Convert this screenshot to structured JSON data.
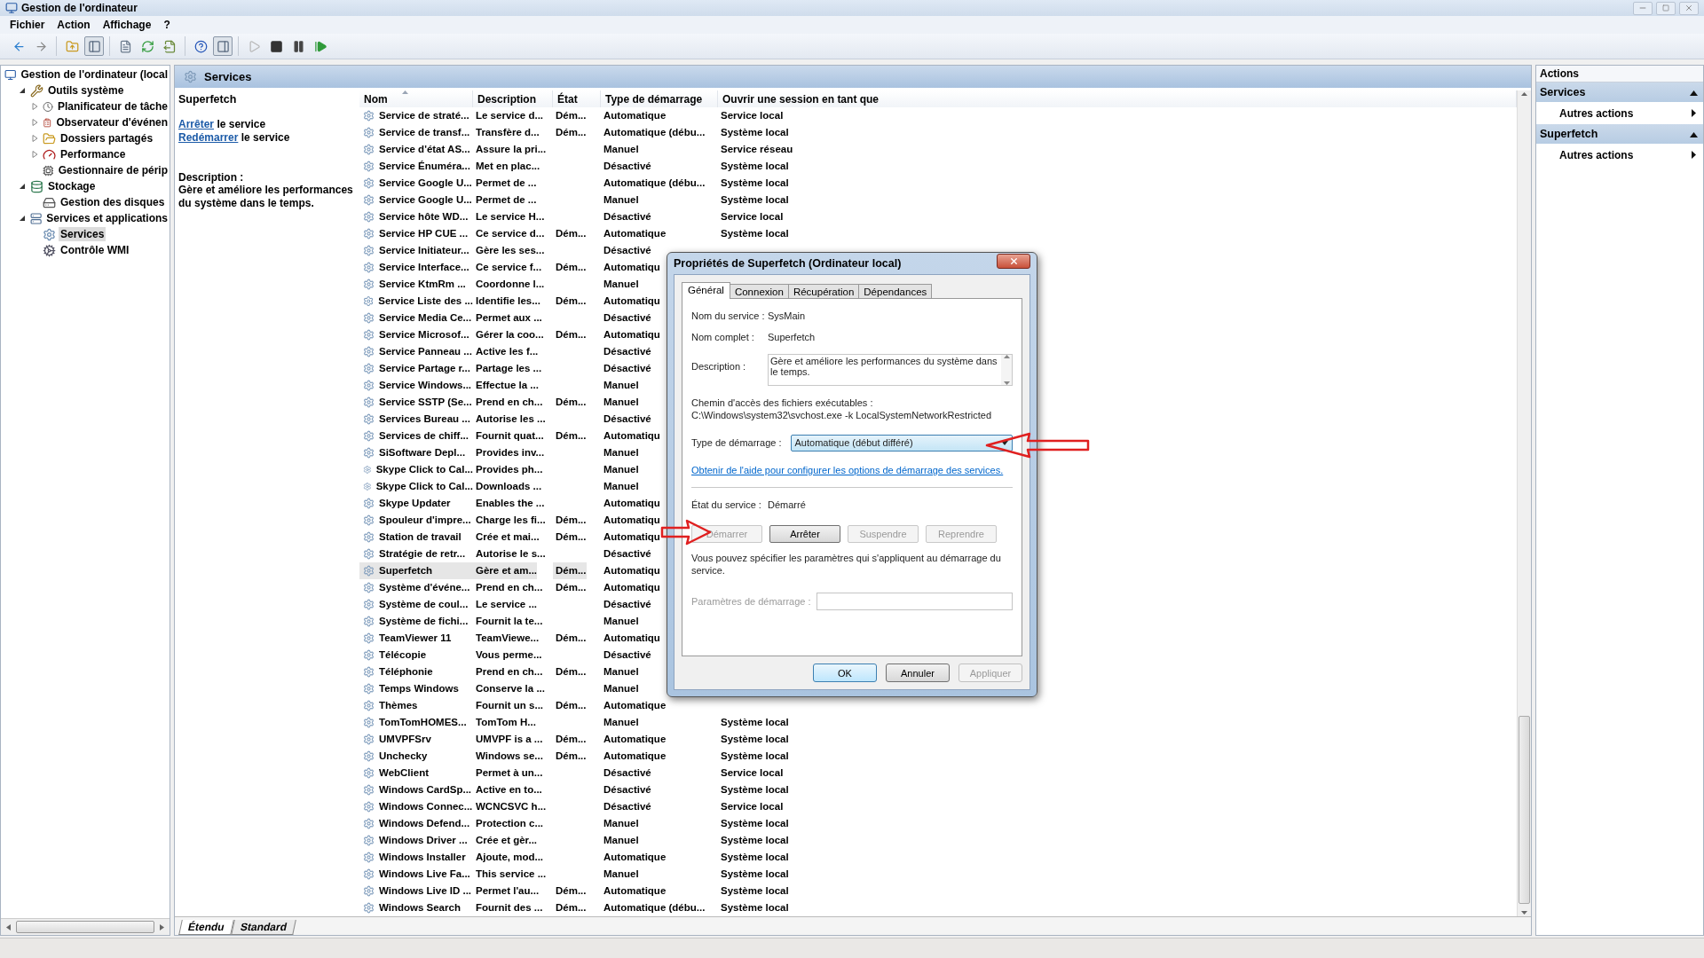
{
  "window": {
    "title": "Gestion de l'ordinateur"
  },
  "menu": [
    "Fichier",
    "Action",
    "Affichage",
    "?"
  ],
  "toolbar": [
    [
      {
        "pressed": false,
        "disabled": false
      },
      {
        "pressed": false,
        "disabled": false
      }
    ],
    [
      {
        "pressed": false,
        "disabled": false
      },
      {
        "pressed": true,
        "disabled": false
      }
    ],
    [
      {
        "pressed": false,
        "disabled": false
      },
      {
        "pressed": false,
        "disabled": false
      },
      {
        "pressed": false,
        "disabled": false
      }
    ],
    [
      {
        "pressed": false,
        "disabled": false
      },
      {
        "pressed": true,
        "disabled": false
      }
    ],
    [
      {
        "pressed": false,
        "disabled": true
      },
      {
        "pressed": false,
        "disabled": false
      },
      {
        "pressed": false,
        "disabled": false
      },
      {
        "pressed": false,
        "disabled": false
      }
    ]
  ],
  "tree": [
    {
      "label": "Gestion de l'ordinateur (local",
      "kind": "computer",
      "selected": false,
      "children": [
        {
          "label": "Outils système",
          "kind": "tools",
          "expanded": true,
          "selected": false,
          "children": [
            {
              "label": "Planificateur de tâche",
              "kind": "clock",
              "expanded": false,
              "selected": false
            },
            {
              "label": "Observateur d'événen",
              "kind": "log",
              "expanded": false,
              "selected": false
            },
            {
              "label": "Dossiers partagés",
              "kind": "folder",
              "expanded": false,
              "selected": false
            },
            {
              "label": "Performance",
              "kind": "gauge",
              "expanded": false,
              "selected": false
            },
            {
              "label": "Gestionnaire de périp",
              "kind": "device",
              "selected": false
            }
          ]
        },
        {
          "label": "Stockage",
          "kind": "storage",
          "expanded": true,
          "selected": false,
          "children": [
            {
              "label": "Gestion des disques",
              "kind": "disk",
              "selected": false
            }
          ]
        },
        {
          "label": "Services et applications",
          "kind": "server",
          "expanded": true,
          "selected": false,
          "children": [
            {
              "label": "Services",
              "kind": "services",
              "selected": true
            },
            {
              "label": "Contrôle WMI",
              "kind": "wmi",
              "selected": false
            }
          ]
        }
      ]
    }
  ],
  "panel_title": "Services",
  "detail": {
    "title": "Superfetch",
    "actions": [
      {
        "link": "Arrêter",
        "text": "le service"
      },
      {
        "link": "Redémarrer",
        "text": "le service"
      }
    ],
    "description_label": "Description :",
    "description": "Gère et améliore les performances du système dans le temps."
  },
  "table": {
    "columns": [
      {
        "label": "Nom",
        "sorted": true
      },
      {
        "label": "Description",
        "sorted": false
      },
      {
        "label": "État",
        "sorted": false
      },
      {
        "label": "Type de démarrage",
        "sorted": false
      },
      {
        "label": "Ouvrir une session en tant que",
        "sorted": false
      }
    ],
    "rows": [
      {
        "name": "Service de straté...",
        "description": "Le service d...",
        "state": "Dém...",
        "startup": "Automatique",
        "logon": "Service local",
        "selected": false
      },
      {
        "name": "Service de transf...",
        "description": "Transfère d...",
        "state": "Dém...",
        "startup": "Automatique (débu...",
        "logon": "Système local",
        "selected": false
      },
      {
        "name": "Service d'état AS...",
        "description": "Assure la pri...",
        "startup": "Manuel",
        "logon": "Service réseau",
        "selected": false
      },
      {
        "name": "Service Énuméra...",
        "description": "Met en plac...",
        "startup": "Désactivé",
        "logon": "Système local",
        "selected": false
      },
      {
        "name": "Service Google U...",
        "description": "Permet de ...",
        "startup": "Automatique (débu...",
        "logon": "Système local",
        "selected": false
      },
      {
        "name": "Service Google U...",
        "description": "Permet de ...",
        "startup": "Manuel",
        "logon": "Système local",
        "selected": false
      },
      {
        "name": "Service hôte WD...",
        "description": "Le service H...",
        "startup": "Désactivé",
        "logon": "Service local",
        "selected": false
      },
      {
        "name": "Service HP CUE ...",
        "description": "Ce service d...",
        "state": "Dém...",
        "startup": "Automatique",
        "logon": "Système local",
        "selected": false
      },
      {
        "name": "Service Initiateur...",
        "description": "Gère les ses...",
        "startup": "Désactivé",
        "selected": false
      },
      {
        "name": "Service Interface...",
        "description": "Ce service f...",
        "state": "Dém...",
        "startup": "Automatiqu",
        "selected": false
      },
      {
        "name": "Service KtmRm ...",
        "description": "Coordonne l...",
        "startup": "Manuel",
        "selected": false
      },
      {
        "name": "Service Liste des ...",
        "description": "Identifie les...",
        "state": "Dém...",
        "startup": "Automatiqu",
        "selected": false
      },
      {
        "name": "Service Media Ce...",
        "description": "Permet aux ...",
        "startup": "Désactivé",
        "selected": false
      },
      {
        "name": "Service Microsof...",
        "description": "Gérer la coo...",
        "state": "Dém...",
        "startup": "Automatiqu",
        "selected": false
      },
      {
        "name": "Service Panneau ...",
        "description": "Active les f...",
        "startup": "Désactivé",
        "selected": false
      },
      {
        "name": "Service Partage r...",
        "description": "Partage les ...",
        "startup": "Désactivé",
        "selected": false
      },
      {
        "name": "Service Windows...",
        "description": "Effectue la ...",
        "startup": "Manuel",
        "selected": false
      },
      {
        "name": "Service SSTP (Se...",
        "description": "Prend en ch...",
        "state": "Dém...",
        "startup": "Manuel",
        "selected": false
      },
      {
        "name": "Services Bureau ...",
        "description": "Autorise les ...",
        "startup": "Désactivé",
        "selected": false
      },
      {
        "name": "Services de chiff...",
        "description": "Fournit quat...",
        "state": "Dém...",
        "startup": "Automatiqu",
        "selected": false
      },
      {
        "name": "SiSoftware Depl...",
        "description": "Provides inv...",
        "startup": "Manuel",
        "selected": false
      },
      {
        "name": "Skype Click to Cal...",
        "description": "Provides ph...",
        "startup": "Manuel",
        "selected": false
      },
      {
        "name": "Skype Click to Cal...",
        "description": "Downloads ...",
        "startup": "Manuel",
        "selected": false
      },
      {
        "name": "Skype Updater",
        "description": "Enables the ...",
        "startup": "Automatiqu",
        "selected": false
      },
      {
        "name": "Spouleur d'impre...",
        "description": "Charge les fi...",
        "state": "Dém...",
        "startup": "Automatiqu",
        "selected": false
      },
      {
        "name": "Station de travail",
        "description": "Crée et mai...",
        "state": "Dém...",
        "startup": "Automatiqu",
        "selected": false
      },
      {
        "name": "Stratégie de retr...",
        "description": "Autorise le s...",
        "startup": "Désactivé",
        "selected": false
      },
      {
        "name": "Superfetch",
        "description": "Gère et am...",
        "state": "Dém...",
        "startup": "Automatiqu",
        "selected": true
      },
      {
        "name": "Système d'événe...",
        "description": "Prend en ch...",
        "state": "Dém...",
        "startup": "Automatiqu",
        "selected": false
      },
      {
        "name": "Système de coul...",
        "description": "Le service ...",
        "startup": "Désactivé",
        "selected": false
      },
      {
        "name": "Système de fichi...",
        "description": "Fournit la te...",
        "startup": "Manuel",
        "selected": false
      },
      {
        "name": "TeamViewer 11",
        "description": "TeamViewe...",
        "state": "Dém...",
        "startup": "Automatiqu",
        "selected": false
      },
      {
        "name": "Télécopie",
        "description": "Vous perme...",
        "startup": "Désactivé",
        "selected": false
      },
      {
        "name": "Téléphonie",
        "description": "Prend en ch...",
        "state": "Dém...",
        "startup": "Manuel",
        "selected": false
      },
      {
        "name": "Temps Windows",
        "description": "Conserve la ...",
        "startup": "Manuel",
        "selected": false
      },
      {
        "name": "Thèmes",
        "description": "Fournit un s...",
        "state": "Dém...",
        "startup": "Automatique",
        "selected": false
      },
      {
        "name": "TomTomHOMES...",
        "description": "TomTom H...",
        "startup": "Manuel",
        "logon": "Système local",
        "selected": false
      },
      {
        "name": "UMVPFSrv",
        "description": "UMVPF is a ...",
        "state": "Dém...",
        "startup": "Automatique",
        "logon": "Système local",
        "selected": false
      },
      {
        "name": "Unchecky",
        "description": "Windows se...",
        "state": "Dém...",
        "startup": "Automatique",
        "logon": "Système local",
        "selected": false
      },
      {
        "name": "WebClient",
        "description": "Permet à un...",
        "startup": "Désactivé",
        "logon": "Service local",
        "selected": false
      },
      {
        "name": "Windows CardSp...",
        "description": "Active en to...",
        "startup": "Désactivé",
        "logon": "Système local",
        "selected": false
      },
      {
        "name": "Windows Connec...",
        "description": "WCNCSVC h...",
        "startup": "Désactivé",
        "logon": "Service local",
        "selected": false
      },
      {
        "name": "Windows Defend...",
        "description": "Protection c...",
        "startup": "Manuel",
        "logon": "Système local",
        "selected": false
      },
      {
        "name": "Windows Driver ...",
        "description": "Crée et gèr...",
        "startup": "Manuel",
        "logon": "Système local",
        "selected": false
      },
      {
        "name": "Windows Installer",
        "description": "Ajoute, mod...",
        "startup": "Automatique",
        "logon": "Système local",
        "selected": false
      },
      {
        "name": "Windows Live Fa...",
        "description": "This service ...",
        "startup": "Manuel",
        "logon": "Système local",
        "selected": false
      },
      {
        "name": "Windows Live ID ...",
        "description": "Permet l'au...",
        "state": "Dém...",
        "startup": "Automatique",
        "logon": "Système local",
        "selected": false
      },
      {
        "name": "Windows Search",
        "description": "Fournit des ...",
        "state": "Dém...",
        "startup": "Automatique (débu...",
        "logon": "Système local",
        "selected": false
      }
    ]
  },
  "view_tabs": [
    {
      "label": "Étendu",
      "selected": true
    },
    {
      "label": "Standard",
      "selected": false
    }
  ],
  "actions": {
    "title": "Actions",
    "sections": [
      {
        "title": "Services",
        "expanded": true,
        "items": [
          "Autres actions"
        ]
      },
      {
        "title": "Superfetch",
        "expanded": true,
        "items": [
          "Autres actions"
        ]
      }
    ]
  },
  "dialog": {
    "title": "Propriétés de Superfetch (Ordinateur local)",
    "tabs": [
      {
        "label": "Général",
        "selected": true
      },
      {
        "label": "Connexion",
        "selected": false
      },
      {
        "label": "Récupération",
        "selected": false
      },
      {
        "label": "Dépendances",
        "selected": false
      }
    ],
    "fields": [
      {
        "label": "Nom du service :",
        "value": "SysMain"
      },
      {
        "label": "Nom complet :",
        "value": "Superfetch"
      }
    ],
    "description": {
      "label": "Description :",
      "value": "Gère et améliore les performances du système dans le temps."
    },
    "path": {
      "label": "Chemin d'accès des fichiers exécutables :",
      "value": "C:\\Windows\\system32\\svchost.exe -k LocalSystemNetworkRestricted"
    },
    "startup": {
      "label": "Type de démarrage :",
      "value": "Automatique (début différé)",
      "focused": true
    },
    "help_link": "Obtenir de l'aide pour configurer les options de démarrage des services.",
    "status": {
      "label": "État du service :",
      "value": "Démarré"
    },
    "service_buttons": [
      {
        "label": "Démarrer",
        "disabled": true
      },
      {
        "label": "Arrêter",
        "disabled": false
      },
      {
        "label": "Suspendre",
        "disabled": true
      },
      {
        "label": "Reprendre",
        "disabled": true
      }
    ],
    "params_note": "Vous pouvez spécifier les paramètres qui s'appliquent au démarrage du service.",
    "params": {
      "label": "Paramètres de démarrage :",
      "disabled": true
    },
    "buttons": [
      {
        "label": "OK",
        "default": true,
        "disabled": false
      },
      {
        "label": "Annuler",
        "default": false,
        "disabled": false
      },
      {
        "label": "Appliquer",
        "default": false,
        "disabled": true
      }
    ]
  }
}
